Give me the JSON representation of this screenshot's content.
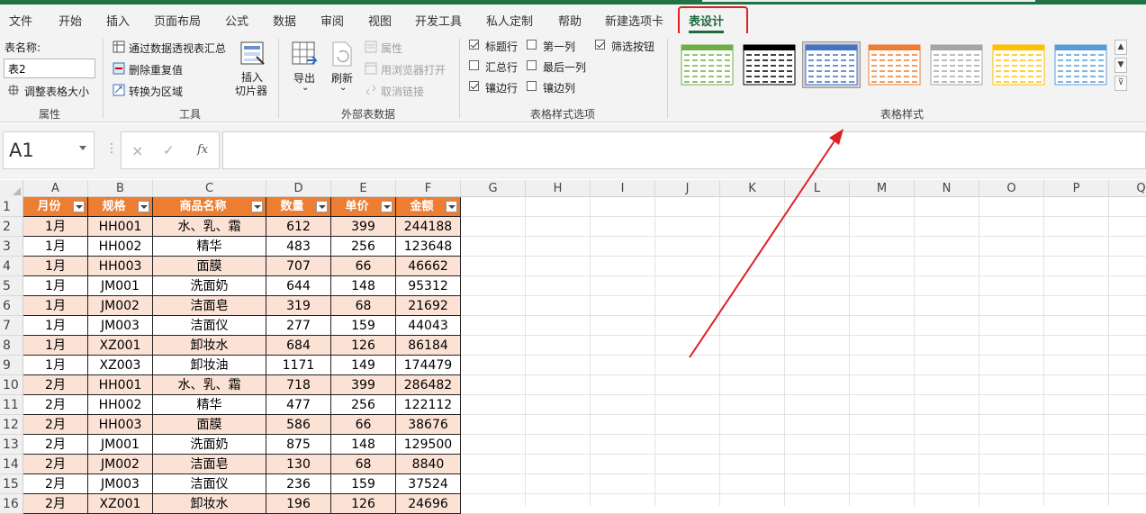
{
  "menu": {
    "tabs": [
      "文件",
      "开始",
      "插入",
      "页面布局",
      "公式",
      "数据",
      "审阅",
      "视图",
      "开发工具",
      "私人定制",
      "帮助",
      "新建选项卡",
      "表设计"
    ],
    "active": "表设计"
  },
  "ribbon": {
    "properties": {
      "tablename_label": "表名称:",
      "tablename_value": "表2",
      "resize_label": "调整表格大小",
      "group_label": "属性"
    },
    "tools": {
      "summarize_pivot": "通过数据透视表汇总",
      "remove_duplicates": "删除重复值",
      "convert_to_range": "转换为区域",
      "insert_slicer": "插入\n切片器",
      "insert_slicer_line1": "插入",
      "insert_slicer_line2": "切片器",
      "group_label": "工具"
    },
    "external": {
      "export": "导出",
      "refresh": "刷新",
      "properties": "属性",
      "open_in_browser": "用浏览器打开",
      "unlink": "取消链接",
      "group_label": "外部表数据"
    },
    "style_options": {
      "header_row": "标题行",
      "total_row": "汇总行",
      "banded_rows": "镶边行",
      "first_column": "第一列",
      "last_column": "最后一列",
      "banded_columns": "镶边列",
      "filter_button": "筛选按钮",
      "header_row_checked": true,
      "total_row_checked": false,
      "banded_rows_checked": true,
      "first_column_checked": false,
      "last_column_checked": false,
      "banded_columns_checked": false,
      "filter_button_checked": true,
      "group_label": "表格样式选项"
    },
    "styles": {
      "group_label": "表格样式",
      "thumbnails": [
        {
          "color": "#70ad47",
          "selected": false
        },
        {
          "color": "#000000",
          "selected": false
        },
        {
          "color": "#4472c4",
          "selected": true
        },
        {
          "color": "#ed7d31",
          "selected": false
        },
        {
          "color": "#a5a5a5",
          "selected": false
        },
        {
          "color": "#ffc000",
          "selected": false
        },
        {
          "color": "#5b9bd5",
          "selected": false
        }
      ]
    }
  },
  "formula_bar": {
    "name_box": "A1",
    "cancel_icon": "×",
    "enter_icon": "✓",
    "fx_label": "fx",
    "formula": ""
  },
  "columns": [
    "A",
    "B",
    "C",
    "D",
    "E",
    "F",
    "G",
    "H",
    "I",
    "J",
    "K",
    "L",
    "M",
    "N",
    "O",
    "P",
    "Q"
  ],
  "rows": [
    "1",
    "2",
    "3",
    "4",
    "5",
    "6",
    "7",
    "8",
    "9",
    "10",
    "11",
    "12",
    "13",
    "14",
    "15",
    "16"
  ],
  "table": {
    "headers": [
      "月份",
      "规格",
      "商品名称",
      "数量",
      "单价",
      "金额"
    ],
    "rows": [
      [
        "1月",
        "HH001",
        "水、乳、霜",
        "612",
        "399",
        "244188"
      ],
      [
        "1月",
        "HH002",
        "精华",
        "483",
        "256",
        "123648"
      ],
      [
        "1月",
        "HH003",
        "面膜",
        "707",
        "66",
        "46662"
      ],
      [
        "1月",
        "JM001",
        "洗面奶",
        "644",
        "148",
        "95312"
      ],
      [
        "1月",
        "JM002",
        "洁面皂",
        "319",
        "68",
        "21692"
      ],
      [
        "1月",
        "JM003",
        "洁面仪",
        "277",
        "159",
        "44043"
      ],
      [
        "1月",
        "XZ001",
        "卸妆水",
        "684",
        "126",
        "86184"
      ],
      [
        "1月",
        "XZ003",
        "卸妆油",
        "1171",
        "149",
        "174479"
      ],
      [
        "2月",
        "HH001",
        "水、乳、霜",
        "718",
        "399",
        "286482"
      ],
      [
        "2月",
        "HH002",
        "精华",
        "477",
        "256",
        "122112"
      ],
      [
        "2月",
        "HH003",
        "面膜",
        "586",
        "66",
        "38676"
      ],
      [
        "2月",
        "JM001",
        "洗面奶",
        "875",
        "148",
        "129500"
      ],
      [
        "2月",
        "JM002",
        "洁面皂",
        "130",
        "68",
        "8840"
      ],
      [
        "2月",
        "JM003",
        "洁面仪",
        "236",
        "159",
        "37524"
      ],
      [
        "2月",
        "XZ001",
        "卸妆水",
        "196",
        "126",
        "24696"
      ]
    ]
  },
  "colors": {
    "header_fill": "#ed7d31",
    "band_fill": "#fbe2d5",
    "annotation_red": "#e02020",
    "excel_green": "#1d6b3e"
  }
}
